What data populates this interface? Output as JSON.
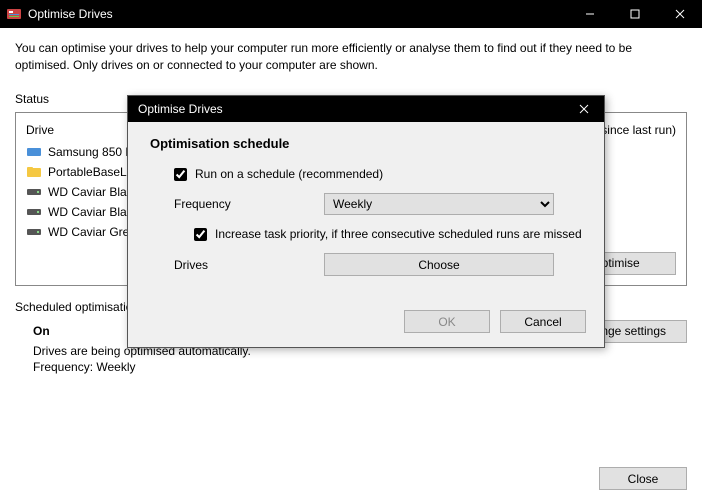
{
  "window": {
    "title": "Optimise Drives"
  },
  "intro": "You can optimise your drives to help your computer run more efficiently or analyse them to find out if they need to be optimised. Only drives on or connected to your computer are shown.",
  "status": {
    "label": "Status",
    "header_drive": "Drive",
    "header_last_run": "since last run)",
    "drives": [
      {
        "name": "Samsung 850 EVO",
        "icon": "ssd"
      },
      {
        "name": "PortableBaseLaye",
        "icon": "folder"
      },
      {
        "name": "WD Caviar Black",
        "icon": "hdd"
      },
      {
        "name": "WD Caviar Black",
        "icon": "hdd"
      },
      {
        "name": "WD Caviar Green",
        "icon": "hdd"
      }
    ],
    "optimise_btn": "Optimise"
  },
  "scheduled": {
    "label": "Scheduled optimisatio",
    "on": "On",
    "line1": "Drives are being optimised automatically.",
    "line2": "Frequency: Weekly",
    "change_btn": "hange settings"
  },
  "footer": {
    "close": "Close"
  },
  "dialog": {
    "title": "Optimise Drives",
    "heading": "Optimisation schedule",
    "run_schedule": "Run on a schedule (recommended)",
    "frequency_label": "Frequency",
    "frequency_value": "Weekly",
    "increase_priority": "Increase task priority, if three consecutive scheduled runs are missed",
    "drives_label": "Drives",
    "choose": "Choose",
    "ok": "OK",
    "cancel": "Cancel"
  }
}
